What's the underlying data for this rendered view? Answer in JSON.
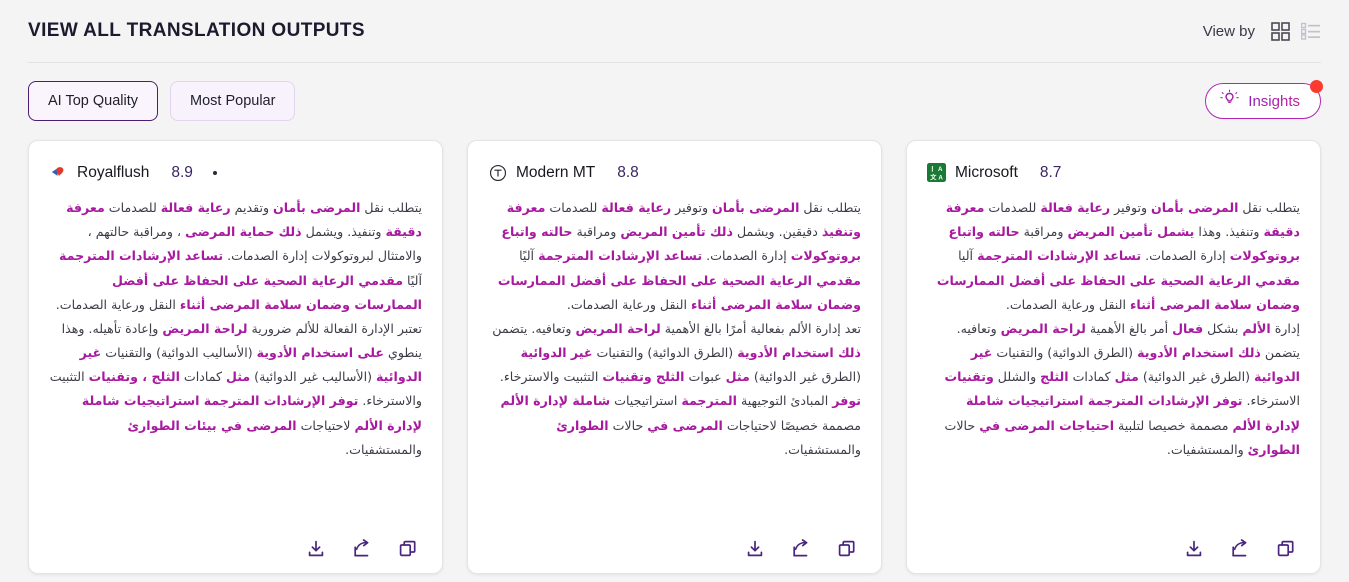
{
  "header": {
    "title": "VIEW ALL TRANSLATION OUTPUTS",
    "view_by_label": "View by",
    "grid_icon": "grid-view-icon",
    "list_icon": "list-view-icon",
    "accent": "#4c1d74"
  },
  "toolbar": {
    "tabs": [
      {
        "label": "AI Top Quality",
        "active": true
      },
      {
        "label": "Most Popular",
        "active": false
      }
    ],
    "insights": {
      "label": "Insights",
      "icon": "lightbulb-icon",
      "has_notification": true,
      "notification_color": "#fb3b30",
      "border_gradient": [
        "#8f1fb8",
        "#c0209a"
      ]
    }
  },
  "cards": [
    {
      "engine": "Royalflush",
      "score": "8.9",
      "has_dot": true,
      "logo": "royalflush-logo-icon",
      "paragraphs": [
        [
          {
            "t": "يتطلب نقل ",
            "h": false
          },
          {
            "t": "المرضى بأمان",
            "h": true
          },
          {
            "t": " وتقديم ",
            "h": false
          },
          {
            "t": "رعاية فعالة",
            "h": true
          },
          {
            "t": " للصدمات ",
            "h": false
          },
          {
            "t": "معرفة دقيقة",
            "h": true
          },
          {
            "t": " وتنفيذ. ويشمل ",
            "h": false
          },
          {
            "t": "ذلك حماية المرضى",
            "h": true
          },
          {
            "t": " ، ومراقبة حالتهم ، والامتثال لبروتوكولات إدارة الصدمات. ",
            "h": false
          },
          {
            "t": "تساعد الإرشادات المترجمة",
            "h": true
          },
          {
            "t": " آليًا ",
            "h": false
          },
          {
            "t": "مقدمي الرعاية الصحية على الحفاظ على أفضل الممارسات وضمان سلامة المرضى أثناء",
            "h": true
          },
          {
            "t": " النقل ورعاية الصدمات.",
            "h": false
          }
        ],
        [
          {
            "t": "تعتبر الإدارة الفعالة للألم ضرورية ",
            "h": false
          },
          {
            "t": "لراحة المريض",
            "h": true
          },
          {
            "t": " وإعادة تأهيله. وهذا ينطوي ",
            "h": false
          },
          {
            "t": "على استخدام الأدوية",
            "h": true
          },
          {
            "t": " (الأساليب الدوائية) والتقنيات ",
            "h": false
          },
          {
            "t": "غير الدوائية",
            "h": true
          },
          {
            "t": " (الأساليب غير الدوائية) ",
            "h": false
          },
          {
            "t": "مثل",
            "h": true
          },
          {
            "t": " كمادات ",
            "h": false
          },
          {
            "t": "الثلج ، وتقنيات",
            "h": true
          },
          {
            "t": " التثبيت والاسترخاء. ",
            "h": false
          },
          {
            "t": "توفر الإرشادات المترجمة استراتيجيات شاملة لإدارة الألم",
            "h": true
          },
          {
            "t": " لاحتياجات ",
            "h": false
          },
          {
            "t": "المرضى في بيئات الطوارئ",
            "h": true
          },
          {
            "t": " والمستشفيات.",
            "h": false
          }
        ]
      ],
      "actions": [
        {
          "name": "download-icon"
        },
        {
          "name": "share-icon"
        },
        {
          "name": "copy-icon"
        }
      ]
    },
    {
      "engine": "Modern MT",
      "score": "8.8",
      "has_dot": false,
      "logo": "modernmt-logo-icon",
      "paragraphs": [
        [
          {
            "t": "يتطلب نقل ",
            "h": false
          },
          {
            "t": "المرضى بأمان",
            "h": true
          },
          {
            "t": " وتوفير ",
            "h": false
          },
          {
            "t": "رعاية فعالة",
            "h": true
          },
          {
            "t": " للصدمات ",
            "h": false
          },
          {
            "t": "معرفة وتنفيذ",
            "h": true
          },
          {
            "t": " دقيقين. ويشمل ",
            "h": false
          },
          {
            "t": "ذلك تأمين المريض",
            "h": true
          },
          {
            "t": " ومراقبة ",
            "h": false
          },
          {
            "t": "حالته واتباع بروتوكولات",
            "h": true
          },
          {
            "t": " إدارة الصدمات. ",
            "h": false
          },
          {
            "t": "تساعد الإرشادات المترجمة",
            "h": true
          },
          {
            "t": " آليًا ",
            "h": false
          },
          {
            "t": "مقدمي الرعاية الصحية على الحفاظ على أفضل الممارسات وضمان سلامة المرضى أثناء",
            "h": true
          },
          {
            "t": " النقل ورعاية الصدمات.",
            "h": false
          }
        ],
        [
          {
            "t": "تعد إدارة الألم بفعالية أمرًا بالغ الأهمية ",
            "h": false
          },
          {
            "t": "لراحة المريض",
            "h": true
          },
          {
            "t": " وتعافيه. يتضمن ",
            "h": false
          },
          {
            "t": "ذلك استخدام الأدوية",
            "h": true
          },
          {
            "t": " (الطرق الدوائية) والتقنيات ",
            "h": false
          },
          {
            "t": "غير الدوائية",
            "h": true
          },
          {
            "t": " (الطرق غير الدوائية) ",
            "h": false
          },
          {
            "t": "مثل",
            "h": true
          },
          {
            "t": " عبوات ",
            "h": false
          },
          {
            "t": "الثلج وتقنيات",
            "h": true
          },
          {
            "t": " التثبيت والاسترخاء. ",
            "h": false
          },
          {
            "t": "توفر",
            "h": true
          },
          {
            "t": " المبادئ التوجيهية ",
            "h": false
          },
          {
            "t": "المترجمة",
            "h": true
          },
          {
            "t": " استراتيجيات ",
            "h": false
          },
          {
            "t": "شاملة لإدارة الألم",
            "h": true
          },
          {
            "t": " مصممة خصيصًا لاحتياجات ",
            "h": false
          },
          {
            "t": "المرضى في",
            "h": true
          },
          {
            "t": " حالات ",
            "h": false
          },
          {
            "t": "الطوارئ",
            "h": true
          },
          {
            "t": " والمستشفيات.",
            "h": false
          }
        ]
      ],
      "actions": [
        {
          "name": "download-icon"
        },
        {
          "name": "share-icon"
        },
        {
          "name": "copy-icon"
        }
      ]
    },
    {
      "engine": "Microsoft",
      "score": "8.7",
      "has_dot": false,
      "logo": "microsoft-translator-logo-icon",
      "paragraphs": [
        [
          {
            "t": "يتطلب نقل ",
            "h": false
          },
          {
            "t": "المرضى بأمان",
            "h": true
          },
          {
            "t": " وتوفير ",
            "h": false
          },
          {
            "t": "رعاية فعالة",
            "h": true
          },
          {
            "t": " للصدمات ",
            "h": false
          },
          {
            "t": "معرفة دقيقة",
            "h": true
          },
          {
            "t": " وتنفيذ. وهذا ",
            "h": false
          },
          {
            "t": "يشمل تأمين المريض",
            "h": true
          },
          {
            "t": " ومراقبة ",
            "h": false
          },
          {
            "t": "حالته واتباع بروتوكولات",
            "h": true
          },
          {
            "t": " إدارة الصدمات. ",
            "h": false
          },
          {
            "t": "تساعد الإرشادات المترجمة",
            "h": true
          },
          {
            "t": " آليا ",
            "h": false
          },
          {
            "t": "مقدمي الرعاية الصحية على الحفاظ على أفضل الممارسات وضمان سلامة المرضى أثناء",
            "h": true
          },
          {
            "t": " النقل ورعاية الصدمات.",
            "h": false
          }
        ],
        [
          {
            "t": "إدارة ",
            "h": false
          },
          {
            "t": "الألم",
            "h": true
          },
          {
            "t": " بشكل ",
            "h": false
          },
          {
            "t": "فعال",
            "h": true
          },
          {
            "t": " أمر بالغ الأهمية ",
            "h": false
          },
          {
            "t": "لراحة المريض",
            "h": true
          },
          {
            "t": " وتعافيه. يتضمن ",
            "h": false
          },
          {
            "t": "ذلك استخدام الأدوية",
            "h": true
          },
          {
            "t": " (الطرق الدوائية) والتقنيات ",
            "h": false
          },
          {
            "t": "غير الدوائية",
            "h": true
          },
          {
            "t": " (الطرق غير الدوائية) ",
            "h": false
          },
          {
            "t": "مثل",
            "h": true
          },
          {
            "t": " كمادات ",
            "h": false
          },
          {
            "t": "الثلج",
            "h": true
          },
          {
            "t": " والشلل ",
            "h": false
          },
          {
            "t": "وتقنيات",
            "h": true
          },
          {
            "t": " الاسترخاء. ",
            "h": false
          },
          {
            "t": "توفر الإرشادات المترجمة استراتيجيات شاملة لإدارة الألم",
            "h": true
          },
          {
            "t": " مصممة خصيصا لتلبية ",
            "h": false
          },
          {
            "t": "احتياجات المرضى في",
            "h": true
          },
          {
            "t": " حالات ",
            "h": false
          },
          {
            "t": "الطوارئ",
            "h": true
          },
          {
            "t": " والمستشفيات.",
            "h": false
          }
        ]
      ],
      "actions": [
        {
          "name": "download-icon"
        },
        {
          "name": "share-icon"
        },
        {
          "name": "copy-icon"
        }
      ]
    }
  ],
  "colors": {
    "highlight": "#a8199f",
    "body_text": "#3c3c48",
    "page_bg": "#f4f4f5",
    "card_bg": "#ffffff",
    "icon_purple": "#4a2580"
  }
}
